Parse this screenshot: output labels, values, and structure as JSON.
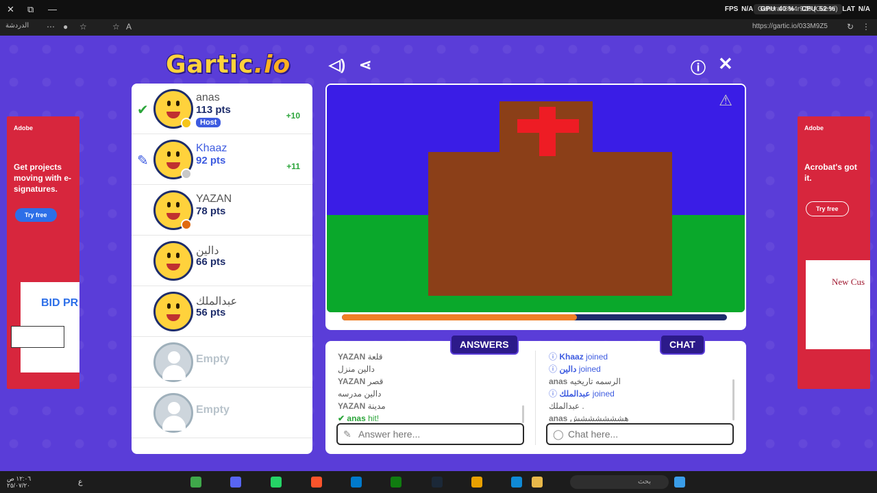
{
  "browser": {
    "window_controls": [
      "✕",
      "⧉",
      "—"
    ],
    "perf": {
      "fps_label": "FPS",
      "fps": "N/A",
      "gpu_label": "GPU",
      "gpu": "40 %",
      "cpu_label": "CPU",
      "cpu": "52 %",
      "lat_label": "LAT",
      "lat": "N/A"
    },
    "tab_chip": "General 8M4r9Z5 (Guestl)",
    "back_label": "الدردشة",
    "url": "https://gartic.io/033M9Z5"
  },
  "game": {
    "logo_main": "Gartic",
    "logo_suffix": ".io",
    "players": [
      {
        "name": "anas",
        "pts": "113 pts",
        "host_label": "Host",
        "gain": "+10",
        "status": "✔",
        "status_color": "#2ba53a",
        "dot_color": "#f5c518",
        "highlight": false
      },
      {
        "name": "Khaaz",
        "pts": "92 pts",
        "gain": "+11",
        "status": "✎",
        "status_color": "#3d5be0",
        "dot_color": "#c8c8c8",
        "highlight": true
      },
      {
        "name": "YAZAN",
        "pts": "78 pts",
        "dot_color": "#e06a10",
        "highlight": false
      },
      {
        "name": "دالين",
        "pts": "66 pts",
        "highlight": false
      },
      {
        "name": "عبدالملك",
        "pts": "56 pts",
        "highlight": false
      }
    ],
    "empty_slots": [
      "Empty",
      "Empty"
    ],
    "progress_fraction": 0.61,
    "answers_tab": "ANSWERS",
    "chat_tab": "CHAT",
    "answers": [
      {
        "user": "YAZAN",
        "text": "قلعة"
      },
      {
        "user": "",
        "text": "دالين منزل"
      },
      {
        "user": "YAZAN",
        "text": "قصر"
      },
      {
        "user": "",
        "text": "دالين مدرسه"
      },
      {
        "user": "YAZAN",
        "text": "مدينة"
      }
    ],
    "hit_user": "anas",
    "hit_text": "hit!",
    "chat": [
      {
        "type": "joined",
        "user": "Khaaz",
        "text": "joined"
      },
      {
        "type": "joined",
        "user": "دالين",
        "text": "joined"
      },
      {
        "type": "msg",
        "user": "anas",
        "text": "الرسمه تاريخيه"
      },
      {
        "type": "joined",
        "user": "عبدالملك",
        "text": "joined"
      },
      {
        "type": "msg",
        "user": "",
        "text": "عبدالملك ."
      },
      {
        "type": "msg",
        "user": "anas",
        "text": "هششششششش"
      }
    ],
    "answer_placeholder": "Answer here...",
    "chat_placeholder": "Chat here..."
  },
  "ads": {
    "left": {
      "brand": "Adobe",
      "text": "Get projects moving with e-signatures.",
      "button": "Try free",
      "doc_text": "BID PR"
    },
    "right": {
      "brand": "Adobe",
      "text": "Acrobat's got it.",
      "button": "Try free",
      "doc_text": "New Cus"
    }
  },
  "taskbar": {
    "time": "١٢:٠٦ ص",
    "date": "٢٥/٠٧/٢٠",
    "lang": "ع",
    "search_placeholder": "بحث"
  },
  "colors": {
    "sky": "#3a1de6",
    "ground": "#0aa82b",
    "building": "#8b3f18",
    "cross": "#ee1c24"
  }
}
